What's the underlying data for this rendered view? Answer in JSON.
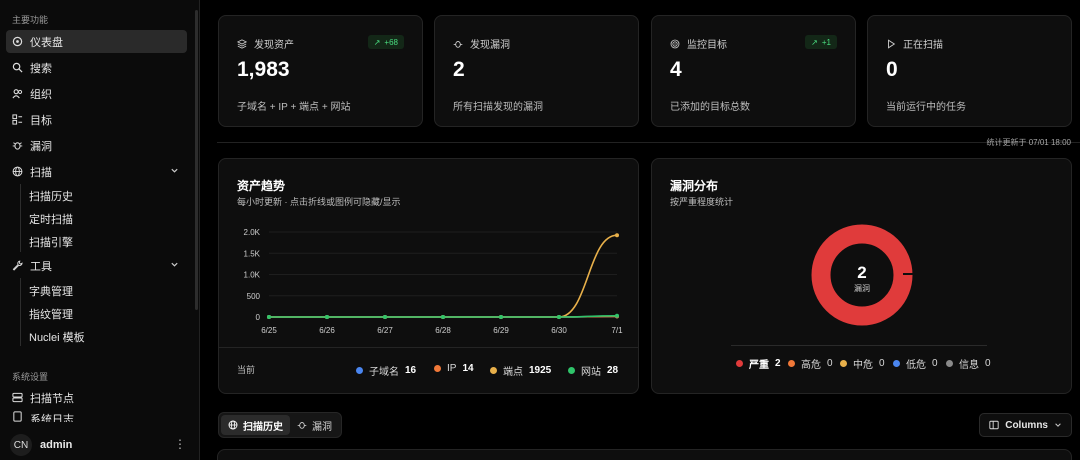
{
  "sidebar": {
    "section_main": "主要功能",
    "items": [
      {
        "label": "仪表盘",
        "icon": "dashboard-icon"
      },
      {
        "label": "搜索",
        "icon": "search-icon"
      },
      {
        "label": "组织",
        "icon": "users-icon"
      },
      {
        "label": "目标",
        "icon": "target-icon"
      },
      {
        "label": "漏洞",
        "icon": "bug-icon"
      },
      {
        "label": "扫描",
        "icon": "globe-icon"
      },
      {
        "label": "工具",
        "icon": "wrench-icon"
      }
    ],
    "scan_sub": [
      "扫描历史",
      "定时扫描",
      "扫描引擎"
    ],
    "tool_sub": [
      "字典管理",
      "指纹管理",
      "Nuclei 模板"
    ],
    "section_settings": "系统设置",
    "settings_items": [
      {
        "label": "扫描节点",
        "icon": "server-icon"
      },
      {
        "label": "系统日志",
        "icon": "file-icon"
      }
    ],
    "user": {
      "initials": "CN",
      "name": "admin"
    }
  },
  "stats": [
    {
      "label": "发现资产",
      "value": "1,983",
      "desc": "子域名 + IP + 端点 + 网站",
      "badge": "+68"
    },
    {
      "label": "发现漏洞",
      "value": "2",
      "desc": "所有扫描发现的漏洞",
      "badge": ""
    },
    {
      "label": "监控目标",
      "value": "4",
      "desc": "已添加的目标总数",
      "badge": "+1"
    },
    {
      "label": "正在扫描",
      "value": "0",
      "desc": "当前运行中的任务",
      "badge": ""
    }
  ],
  "updated_text": "统计更新于 07/01 18:00",
  "asset_trend": {
    "title": "资产趋势",
    "subtitle": "每小时更新 · 点击折线或图例可隐藏/显示",
    "current_label": "当前",
    "legend": [
      {
        "name": "子域名",
        "value": "16",
        "color": "#4a86f0"
      },
      {
        "name": "IP",
        "value": "14",
        "color": "#f07838"
      },
      {
        "name": "端点",
        "value": "1925",
        "color": "#e8b04a"
      },
      {
        "name": "网站",
        "value": "28",
        "color": "#2fc46a"
      }
    ]
  },
  "chart_data": {
    "type": "line",
    "x": [
      "6/25",
      "6/26",
      "6/27",
      "6/28",
      "6/29",
      "6/30",
      "7/1"
    ],
    "yticks": [
      "0",
      "500",
      "1.0K",
      "1.5K",
      "2.0K"
    ],
    "ylim": [
      0,
      2000
    ],
    "series": [
      {
        "name": "子域名",
        "color": "#4a86f0",
        "values": [
          0,
          0,
          0,
          0,
          0,
          0,
          16
        ]
      },
      {
        "name": "IP",
        "color": "#f07838",
        "values": [
          0,
          0,
          0,
          0,
          0,
          0,
          14
        ]
      },
      {
        "name": "端点",
        "color": "#e8b04a",
        "values": [
          0,
          0,
          0,
          0,
          0,
          0,
          1925
        ]
      },
      {
        "name": "网站",
        "color": "#2fc46a",
        "values": [
          0,
          0,
          0,
          0,
          0,
          0,
          28
        ]
      }
    ]
  },
  "vuln_dist": {
    "title": "漏洞分布",
    "subtitle": "按严重程度统计",
    "total": "2",
    "total_label": "漏洞",
    "legend": [
      {
        "name": "严重",
        "value": "2",
        "color": "#e03b3b"
      },
      {
        "name": "高危",
        "value": "0",
        "color": "#f07838"
      },
      {
        "name": "中危",
        "value": "0",
        "color": "#e8b04a"
      },
      {
        "name": "低危",
        "value": "0",
        "color": "#4a86f0"
      },
      {
        "name": "信息",
        "value": "0",
        "color": "#8a8a8a"
      }
    ]
  },
  "tabs": [
    {
      "label": "扫描历史",
      "icon": "globe-icon"
    },
    {
      "label": "漏洞",
      "icon": "bug-icon"
    }
  ],
  "columns_button": "Columns"
}
